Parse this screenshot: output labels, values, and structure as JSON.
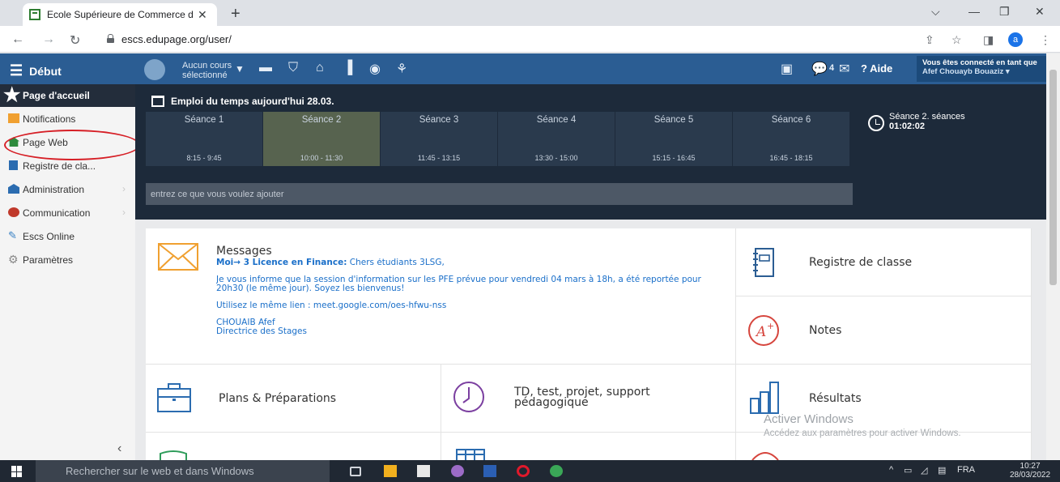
{
  "browser": {
    "tab_title": "Ecole Supérieure de Commerce d",
    "url": "escs.edupage.org/user/",
    "profile_initial": "a"
  },
  "header": {
    "menu_label": "Début",
    "course_label_line1": "Aucun cours",
    "course_label_line2": "sélectionné",
    "messages_count": "4",
    "help_label": "Aide",
    "user_line1": "Vous êtes connecté en tant que",
    "user_line2": "Afef Chouayb Bouaziz"
  },
  "sidebar": {
    "home_label": "Page d'accueil",
    "items": [
      {
        "label": "Notifications",
        "icon": "envelope-icon",
        "color": "#f0a030"
      },
      {
        "label": "Page Web",
        "icon": "home-icon",
        "color": "#2e8b3d"
      },
      {
        "label": "Registre de cla...",
        "icon": "register-icon",
        "color": "#2b6cb0"
      },
      {
        "label": "Administration",
        "icon": "bank-icon",
        "color": "#2b6cb0"
      },
      {
        "label": "Communication",
        "icon": "chat-icon",
        "color": "#c0392b"
      },
      {
        "label": "Escs Online",
        "icon": "pen-icon",
        "color": "#3b82c4"
      },
      {
        "label": "Paramètres",
        "icon": "gear-icon",
        "color": "#888888"
      }
    ]
  },
  "timetable": {
    "title": "Emploi du temps aujourd'hui 28.03.",
    "slots": [
      {
        "name": "Séance 1",
        "time": "8:15 - 9:45"
      },
      {
        "name": "Séance 2",
        "time": "10:00 - 11:30"
      },
      {
        "name": "Séance 3",
        "time": "11:45 - 13:15"
      },
      {
        "name": "Séance 4",
        "time": "13:30 - 15:00"
      },
      {
        "name": "Séance 5",
        "time": "15:15 - 16:45"
      },
      {
        "name": "Séance 6",
        "time": "16:45 - 18:15"
      }
    ],
    "active_slot": "Séance 2",
    "side_label": "Séance 2. séances",
    "side_time": "01:02:02",
    "input_placeholder": "entrez ce que vous voulez ajouter"
  },
  "messages": {
    "title": "Messages",
    "line1_bold": "Moi→ 3 Licence en Finance:",
    "line1_rest": " Chers étudiants 3LSG,",
    "p2": "Je vous informe que la session d'information sur les PFE prévue pour vendredi 04 mars à 18h, a été reportée pour 20h30 (le même jour). Soyez les bienvenus!",
    "p3": "Utilisez le même lien : meet.google.com/oes-hfwu-nss",
    "sign1": "CHOUAIB Afef",
    "sign2": "Directrice des Stages"
  },
  "tiles": {
    "registre": "Registre de classe",
    "notes": "Notes",
    "plans": "Plans & Préparations",
    "td": "TD, test, projet, support pédagogique",
    "resultats": "Résultats"
  },
  "watermark": {
    "line1": "Activer Windows",
    "line2": "Accédez aux paramètres pour activer Windows."
  },
  "taskbar": {
    "search_placeholder": "Rechercher sur le web et dans Windows",
    "lang": "FRA",
    "time": "10:27",
    "date": "28/03/2022"
  }
}
